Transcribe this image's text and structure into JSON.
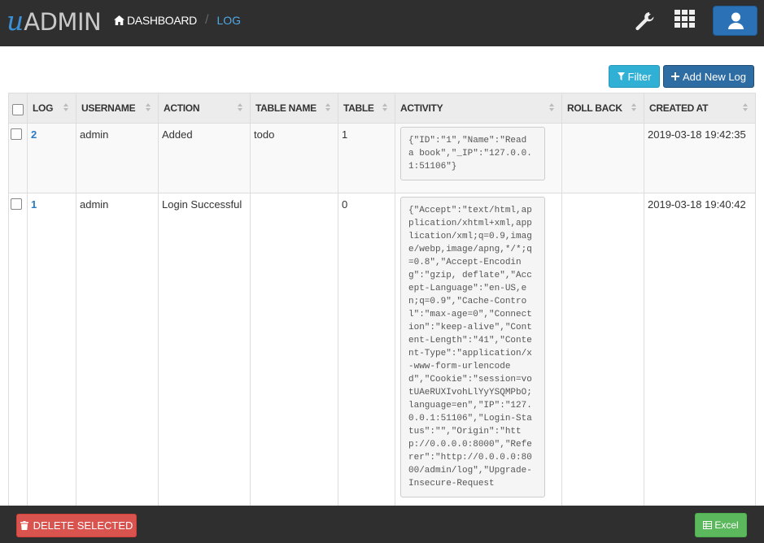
{
  "app": {
    "logo_u": "u",
    "logo_admin": "ADMIN"
  },
  "breadcrumb": {
    "home": "DASHBOARD",
    "current": "LOG"
  },
  "actions": {
    "filter": "Filter",
    "add": "Add New Log"
  },
  "table": {
    "columns": [
      "LOG",
      "USERNAME",
      "ACTION",
      "TABLE NAME",
      "TABLE",
      "ACTIVITY",
      "ROLL BACK",
      "CREATED AT"
    ],
    "rows": [
      {
        "id": "2",
        "username": "admin",
        "action": "Added",
        "table_name": "todo",
        "table": "1",
        "activity": "{\"ID\":\"1\",\"Name\":\"Read a book\",\"_IP\":\"127.0.0.1:51106\"}",
        "roll_back": "",
        "created_at": "2019-03-18 19:42:35"
      },
      {
        "id": "1",
        "username": "admin",
        "action": "Login Successful",
        "table_name": "",
        "table": "0",
        "activity": "{\"Accept\":\"text/html,application/xhtml+xml,application/xml;q=0.9,image/webp,image/apng,*/*;q=0.8\",\"Accept-Encoding\":\"gzip, deflate\",\"Accept-Language\":\"en-US,en;q=0.9\",\"Cache-Control\":\"max-age=0\",\"Connection\":\"keep-alive\",\"Content-Length\":\"41\",\"Content-Type\":\"application/x-www-form-urlencoded\",\"Cookie\":\"session=votUAeRUXIvohLlYyYSQMPbO; language=en\",\"IP\":\"127.0.0.1:51106\",\"Login-Status\":\"\",\"Origin\":\"http://0.0.0.0:8000\",\"Referer\":\"http://0.0.0.0:8000/admin/log\",\"Upgrade-Insecure-Request",
        "roll_back": "",
        "created_at": "2019-03-18 19:40:42"
      }
    ]
  },
  "footer": {
    "delete": "DELETE SELECTED",
    "excel": "Excel"
  },
  "colors": {
    "topbar": "#2f2f2f",
    "accent": "#2a72b5",
    "link": "#2a7ac4",
    "danger": "#d9534f",
    "success": "#5cb85c",
    "info": "#31b0d5"
  }
}
